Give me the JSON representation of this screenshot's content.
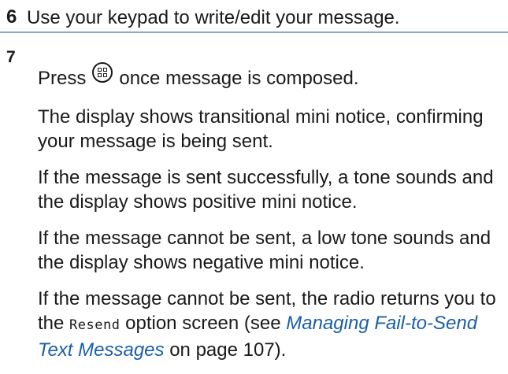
{
  "steps": [
    {
      "number": "6",
      "text": "Use your keypad to write/edit your message."
    },
    {
      "number": "7",
      "press_prefix": "Press",
      "press_icon": "menu-ok-icon",
      "press_suffix": "once message is composed.",
      "para1": "The display shows transitional mini notice, confirming your message is being sent.",
      "para2": "If the message is sent successfully, a tone sounds and the display shows positive mini notice.",
      "para3": "If the message cannot be sent, a low tone sounds and the display shows negative mini notice.",
      "para4_before": "If the message cannot be sent, the radio returns you to the",
      "para4_code": "Resend",
      "para4_mid": "option screen (see",
      "para4_link": "Managing Fail-to-Send Text Messages",
      "para4_after": "on page 107)."
    }
  ],
  "colors": {
    "divider": "#8aa6c2",
    "link": "#1a5ea8"
  }
}
